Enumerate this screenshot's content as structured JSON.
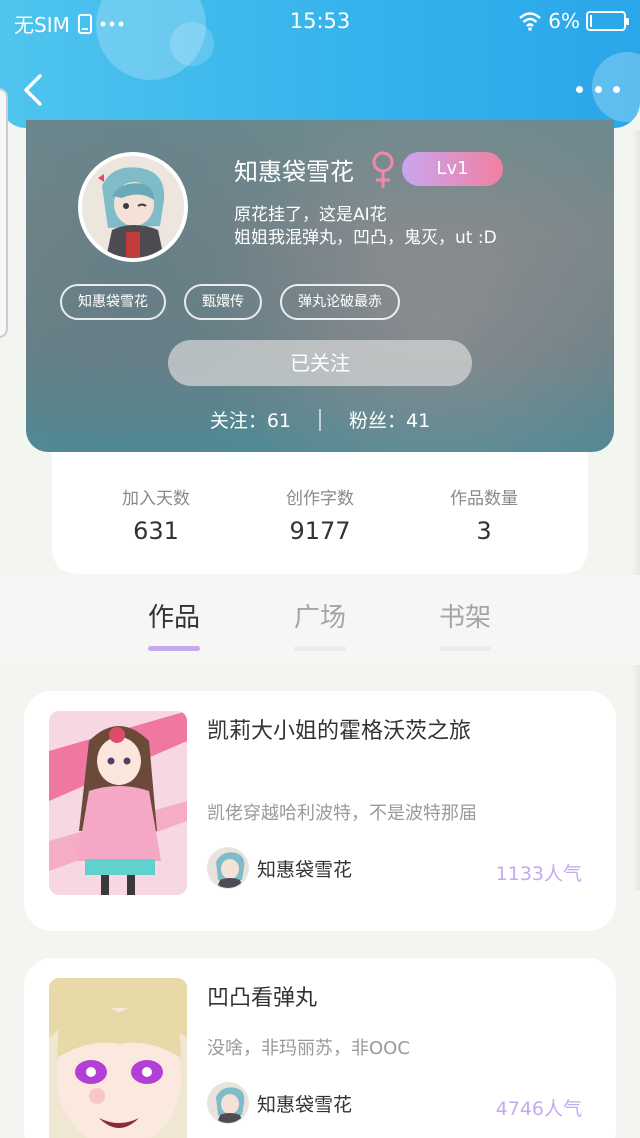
{
  "status_bar": {
    "carrier": "无SIM",
    "time": "15:53",
    "battery": "6%",
    "battery_level": 0.06
  },
  "profile": {
    "name": "知惠袋雪花",
    "level": "Lv1",
    "bio_line1": "原花挂了，这是AI花",
    "bio_line2": "姐姐我混弹丸，凹凸，鬼灭，ut :D",
    "tags": [
      "知惠袋雪花",
      "甄嬛传",
      "弹丸论破最赤"
    ],
    "follow_button": "已关注",
    "following_label": "关注：61",
    "followers_label": "粉丝：41"
  },
  "stats": [
    {
      "label": "加入天数",
      "value": "631"
    },
    {
      "label": "创作字数",
      "value": "9177"
    },
    {
      "label": "作品数量",
      "value": "3"
    }
  ],
  "tabs": [
    "作品",
    "广场",
    "书架"
  ],
  "works": [
    {
      "title": "凯莉大小姐的霍格沃茨之旅",
      "desc": "凯佬穿越哈利波特，不是波特那届",
      "author": "知惠袋雪花",
      "popularity": "1133人气"
    },
    {
      "title": "凹凸看弹丸",
      "desc": "没啥，非玛丽苏，非OOC",
      "author": "知惠袋雪花",
      "popularity": "4746人气"
    }
  ],
  "colors": {
    "header": "#36b3ec",
    "accent": "#c6aaf0",
    "level_badge_from": "#c9a6f0",
    "level_badge_to": "#f27fa0",
    "gender": "#f08aa8"
  },
  "icons": [
    "back-chevron-icon",
    "more-dots-icon",
    "wifi-icon",
    "phone-icon",
    "female-icon",
    "battery-icon"
  ]
}
